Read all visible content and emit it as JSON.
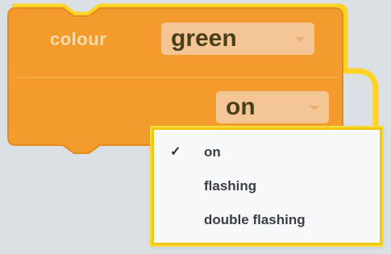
{
  "block": {
    "label": "colour",
    "colour_value": "green",
    "state_value": "on"
  },
  "menu": {
    "selected_index": 0,
    "items": [
      {
        "label": "on",
        "selected": true
      },
      {
        "label": "flashing",
        "selected": false
      },
      {
        "label": "double flashing",
        "selected": false
      }
    ]
  },
  "colors": {
    "block_orange": "#f39c2d",
    "block_highlight": "#ffc629",
    "field_background": "#f5c695",
    "menu_border": "#f0c814",
    "page_background": "#dbe0e4"
  }
}
